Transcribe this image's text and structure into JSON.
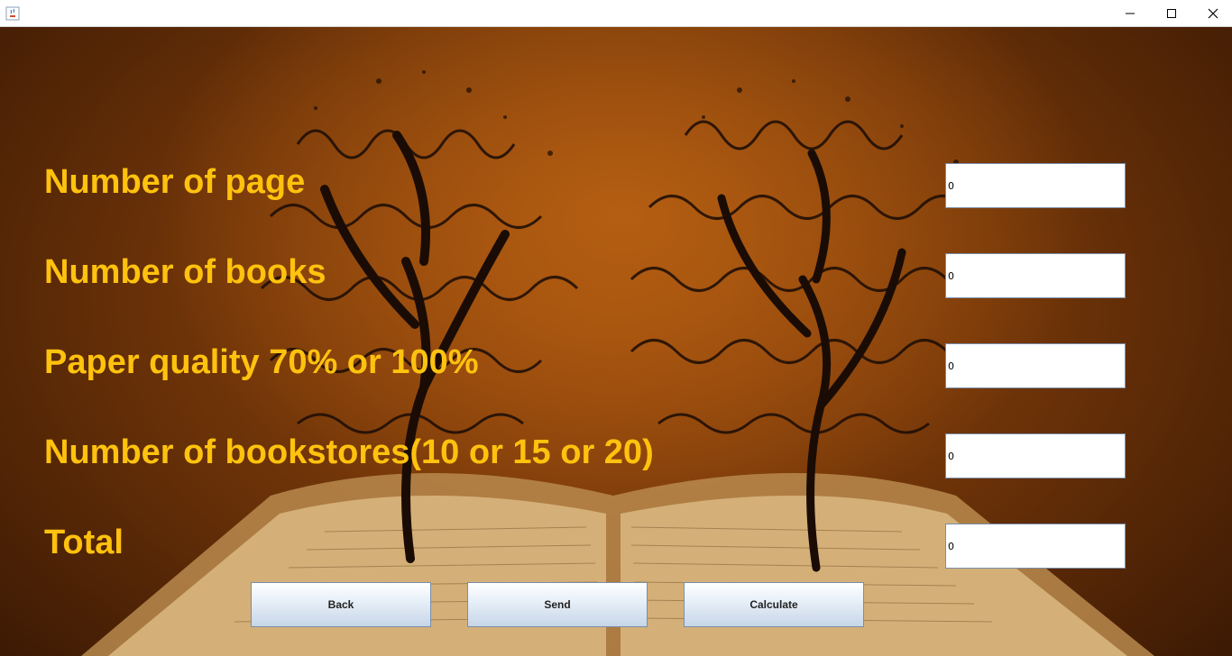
{
  "window": {
    "app_icon": "java-coffee-cup-icon",
    "controls": [
      "minimize-icon",
      "maximize-icon",
      "close-icon"
    ]
  },
  "form": {
    "fields": [
      {
        "label": "Number of page",
        "value": "0"
      },
      {
        "label": "Number of books",
        "value": "0"
      },
      {
        "label": "Paper quality 70% or 100%",
        "value": "0"
      },
      {
        "label": "Number of bookstores(10 or 15 or 20)",
        "value": "0"
      },
      {
        "label": "Total",
        "value": "0"
      }
    ]
  },
  "buttons": {
    "back": "Back",
    "send": "Send",
    "calculate": "Calculate"
  },
  "colors": {
    "label_text": "#ffc20e",
    "background_orange": "#9a4a0c",
    "background_dark": "#3d1a04"
  }
}
